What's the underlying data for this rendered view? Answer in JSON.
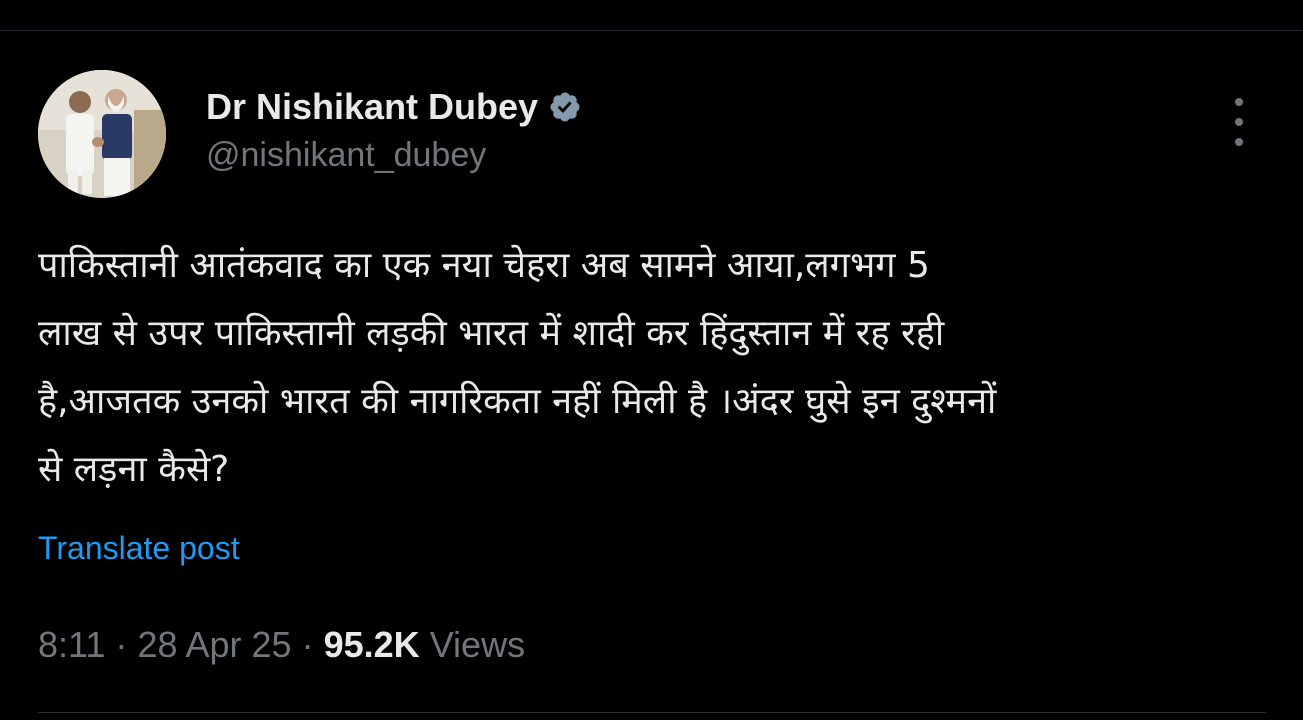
{
  "post": {
    "author": {
      "display_name": "Dr Nishikant Dubey",
      "handle": "@nishikant_dubey",
      "verified_icon": "verified-badge-icon",
      "avatar_icon": "avatar-photo"
    },
    "text_lines": [
      "पाकिस्तानी आतंकवाद का एक नया चेहरा अब सामने आया,लगभग 5",
      "लाख से उपर पाकिस्तानी लड़की भारत में शादी कर हिंदुस्तान में रह रही",
      "है,आजतक उनको भारत की नागरिकता नहीं मिली है ।अंदर घुसे इन दुश्मनों",
      "से लड़ना कैसे?"
    ],
    "translate_label": "Translate post",
    "time": "8:11",
    "separator": "·",
    "date": "28 Apr 25",
    "views_count": "95.2K",
    "views_label": "Views",
    "more_icon": "more-options-icon"
  },
  "colors": {
    "background": "#000000",
    "primary_text": "#e7e9ea",
    "secondary_text": "#71767b",
    "link": "#1d9bf0",
    "verified": "#829aab"
  }
}
